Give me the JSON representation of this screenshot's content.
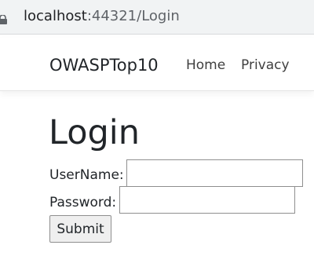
{
  "browser": {
    "url_host": "localhost",
    "url_rest": ":44321/Login"
  },
  "navbar": {
    "brand": "OWASPTop10",
    "links": [
      {
        "label": "Home"
      },
      {
        "label": "Privacy"
      }
    ]
  },
  "main": {
    "title": "Login",
    "form": {
      "username_label": "UserName:",
      "username_value": "",
      "password_label": "Password:",
      "password_value": "",
      "submit_label": "Submit"
    }
  }
}
